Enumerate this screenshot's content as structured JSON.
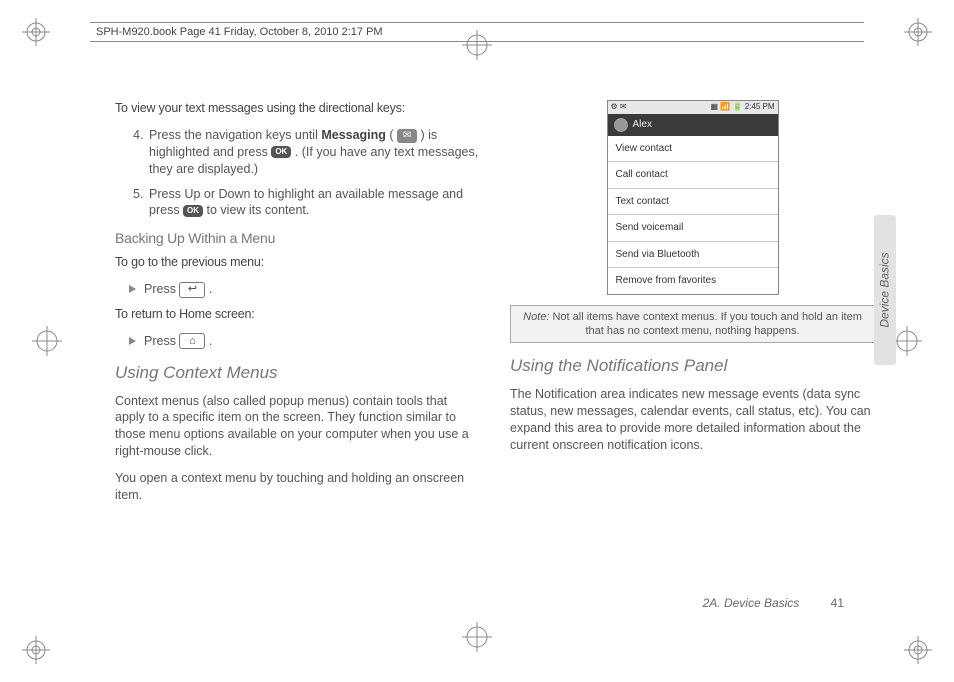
{
  "header": {
    "book_info": "SPH-M920.book  Page 41  Friday, October 8, 2010  2:17 PM"
  },
  "left": {
    "intro": "To view your text messages using the directional keys:",
    "steps": [
      {
        "num": "4.",
        "pre": "Press the navigation keys until ",
        "bold": "Messaging",
        "mid": " ( ",
        "post1": " ) is highlighted and press ",
        "post2": " . (If you have any text messages, they are displayed.)"
      },
      {
        "num": "5.",
        "pre": "Press Up or Down to highlight an available message and press ",
        "post": " to view its content."
      }
    ],
    "h_backing": "Backing Up Within a Menu",
    "goto_prev": "To go to the previous menu:",
    "press1": "Press ",
    "return_home": "To return to Home screen:",
    "press2": "Press ",
    "h_context": "Using Context Menus",
    "p_context1": "Context menus (also called popup menus) contain tools that apply to a specific item on the screen. They function similar to those menu options available on your computer when you use a right-mouse click.",
    "p_context2": "You open a context menu by touching and holding an onscreen item."
  },
  "phone": {
    "status_left": "⚙ ✉",
    "status_right": "▦ 📶 🔋 2:45 PM",
    "header_name": "Alex",
    "items": [
      "View contact",
      "Call contact",
      "Text contact",
      "Send voicemail",
      "Send via Bluetooth",
      "Remove from favorites"
    ]
  },
  "note": {
    "label": "Note:",
    "text": " Not all items have context menus. If you touch and hold an item that has no context menu, nothing happens."
  },
  "right": {
    "h_notif": "Using the Notifications Panel",
    "p_notif": "The Notification area indicates new message events (data sync status, new messages, calendar events, call status, etc). You can expand this area to provide more detailed information about the current onscreen notification icons."
  },
  "side_tab": "Device Basics",
  "footer": {
    "section": "2A. Device Basics",
    "page": "41"
  },
  "icons": {
    "ok": "OK",
    "back": "↩",
    "home": "⌂"
  }
}
